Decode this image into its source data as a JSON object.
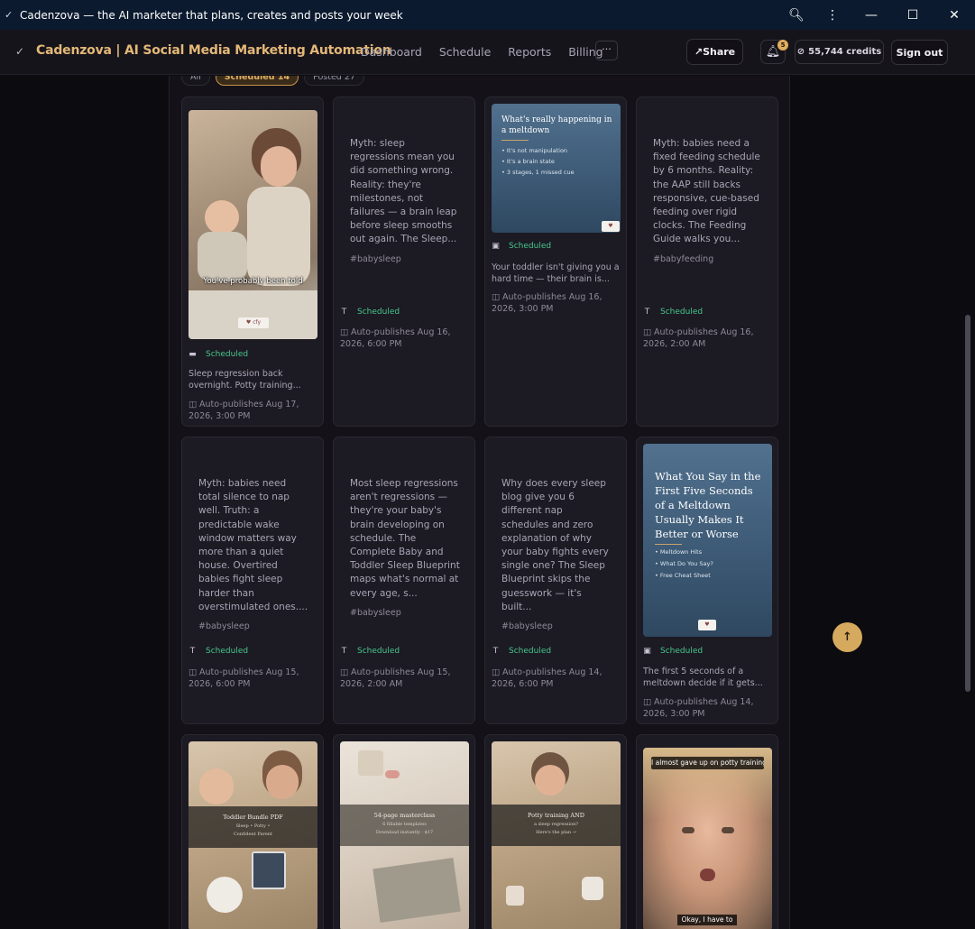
{
  "window": {
    "title": "Cadenzova — the AI marketer that plans, creates and posts your week",
    "app_icon": "check-icon",
    "controls": [
      "zoom-icon",
      "more-vert-icon",
      "minimize-icon",
      "maximize-icon",
      "close-icon"
    ]
  },
  "header": {
    "brand": "Cadenzova | AI Social Media Marketing Automation",
    "nav": [
      "Dashboard",
      "Schedule",
      "Reports",
      "Billing"
    ],
    "more": "···",
    "share": "Share",
    "notifications_count": "5",
    "credits": "55,744 credits",
    "sign_out": "Sign out"
  },
  "filters": [
    {
      "label": "All",
      "active": false
    },
    {
      "label": "Scheduled 14",
      "active": true
    },
    {
      "label": "Posted 27",
      "active": false
    }
  ],
  "cards": [
    {
      "kind": "image",
      "media_overlay": "You've probably been told",
      "status": "Scheduled",
      "type_icon": "video-icon",
      "caption": "Sleep regression back overnight. Potty training...",
      "schedule": "Auto-publishes Aug 17, 2026, 3:00 PM"
    },
    {
      "kind": "text",
      "body": "Myth: sleep regressions mean you did something wrong. Reality: they're milestones, not failures — a brain leap before sleep smooths out again. The Sleep...",
      "tag": "#babysleep",
      "status": "Scheduled",
      "type_icon": "text-icon",
      "schedule": "Auto-publishes Aug 16, 2026, 6:00 PM"
    },
    {
      "kind": "image",
      "media_title": "What's really happening in a meltdown",
      "media_list": [
        "It's not manipulation",
        "It's a brain state",
        "3 stages, 1 missed cue"
      ],
      "status": "Scheduled",
      "type_icon": "image-icon",
      "caption": "Your toddler isn't giving you a hard time — their brain is...",
      "schedule": "Auto-publishes Aug 16, 2026, 3:00 PM"
    },
    {
      "kind": "text",
      "body": "Myth: babies need a fixed feeding schedule by 6 months. Reality: the AAP still backs responsive, cue-based feeding over rigid clocks. The Feeding Guide walks you...",
      "tag": "#babyfeeding",
      "status": "Scheduled",
      "type_icon": "text-icon",
      "schedule": "Auto-publishes Aug 16, 2026, 2:00 AM"
    },
    {
      "kind": "text",
      "body": "Myth: babies need total silence to nap well. Truth: a predictable wake window matters way more than a quiet house. Overtired babies fight sleep harder than overstimulated ones....",
      "tag": "#babysleep",
      "status": "Scheduled",
      "type_icon": "text-icon",
      "schedule": "Auto-publishes Aug 15, 2026, 6:00 PM"
    },
    {
      "kind": "text",
      "body": "Most sleep regressions aren't regressions — they're your baby's brain developing on schedule. The Complete Baby and Toddler Sleep Blueprint maps what's normal at every age, s...",
      "tag": "#babysleep",
      "status": "Scheduled",
      "type_icon": "text-icon",
      "schedule": "Auto-publishes Aug 15, 2026, 2:00 AM"
    },
    {
      "kind": "text",
      "body": "Why does every sleep blog give you 6 different nap schedules and zero explanation of why your baby fights every single one? The Sleep Blueprint skips the guesswork — it's built...",
      "tag": "#babysleep",
      "status": "Scheduled",
      "type_icon": "text-icon",
      "schedule": "Auto-publishes Aug 14, 2026, 6:00 PM"
    },
    {
      "kind": "image",
      "media_title": "What You Say in the First Five Seconds of a Meltdown Usually Makes It Better or Worse",
      "media_list": [
        "Meltdown Hits",
        "What Do You Say?",
        "Free Cheat Sheet"
      ],
      "status": "Scheduled",
      "type_icon": "image-icon",
      "caption": "The first 5 seconds of a meltdown decide if it gets...",
      "schedule": "Auto-publishes Aug 14, 2026, 3:00 PM"
    },
    {
      "kind": "image",
      "media_band": [
        "Toddler Bundle PDF",
        "Sleep • Potty •",
        "Confident Parent"
      ]
    },
    {
      "kind": "image",
      "media_band": [
        "54-page masterclass",
        "6 fillable templates",
        "Download instantly · $17"
      ]
    },
    {
      "kind": "image",
      "media_band": [
        "Potty training AND",
        "a sleep regression?",
        "Here's the plan →"
      ]
    },
    {
      "kind": "image",
      "media_overlay": "I almost gave up on potty training",
      "media_overlay2": "Okay, I have to"
    }
  ],
  "scroll_top_icon": "arrow-up-icon"
}
